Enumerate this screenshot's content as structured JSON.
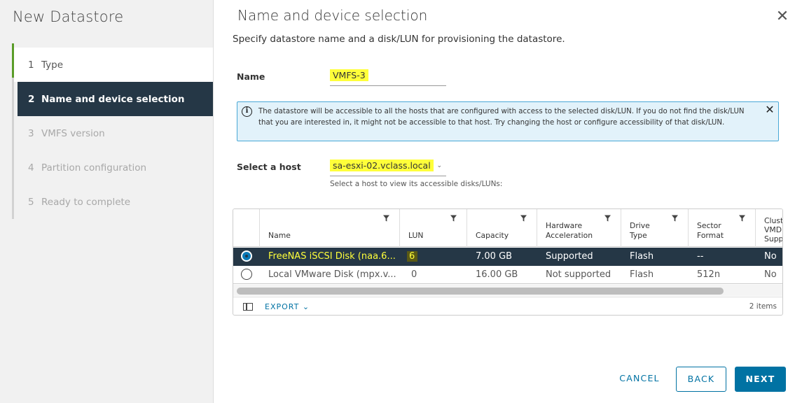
{
  "sidebar": {
    "title": "New Datastore",
    "steps": [
      {
        "num": "1",
        "label": "Type"
      },
      {
        "num": "2",
        "label": "Name and device selection"
      },
      {
        "num": "3",
        "label": "VMFS version"
      },
      {
        "num": "4",
        "label": "Partition configuration"
      },
      {
        "num": "5",
        "label": "Ready to complete"
      }
    ]
  },
  "main": {
    "title": "Name and device selection",
    "subtitle": "Specify datastore name and a disk/LUN for provisioning the datastore.",
    "name_label": "Name",
    "name_value": "VMFS-3",
    "info_text": "The datastore will be accessible to all the hosts that are configured with access to the selected disk/LUN. If you do not find the disk/LUN that you are interested in, it might not be accessible to that host. Try changing the host or configure accessibility of that disk/LUN.",
    "host_label": "Select a host",
    "host_value": "sa-esxi-02.vclass.local",
    "host_hint": "Select a host to view its accessible disks/LUNs:"
  },
  "grid": {
    "columns": [
      {
        "label": "Name"
      },
      {
        "label": "LUN"
      },
      {
        "label": "Capacity"
      },
      {
        "label_line1": "Hardware",
        "label_line2": "Acceleration"
      },
      {
        "label_line1": "Drive",
        "label_line2": "Type"
      },
      {
        "label_line1": "Sector",
        "label_line2": "Format"
      },
      {
        "label_line1": "Clust",
        "label_line2": "VMD",
        "label_line3": "Supp"
      }
    ],
    "rows": [
      {
        "name": "FreeNAS iSCSI Disk (naa.6...",
        "lun": "6",
        "capacity": "7.00 GB",
        "hw": "Supported",
        "drive": "Flash",
        "sector": "--",
        "cluster": "No",
        "selected": true
      },
      {
        "name": "Local VMware Disk (mpx.v...",
        "lun": "0",
        "capacity": "16.00 GB",
        "hw": "Not supported",
        "drive": "Flash",
        "sector": "512n",
        "cluster": "No",
        "selected": false
      }
    ],
    "export_label": "EXPORT",
    "items_count": "2 items"
  },
  "buttons": {
    "cancel": "CANCEL",
    "back": "BACK",
    "next": "NEXT"
  },
  "colors": {
    "accent": "#0072a3",
    "selected_bg": "#253746",
    "highlight": "#ffff3a",
    "done_green": "#5a9c28"
  }
}
